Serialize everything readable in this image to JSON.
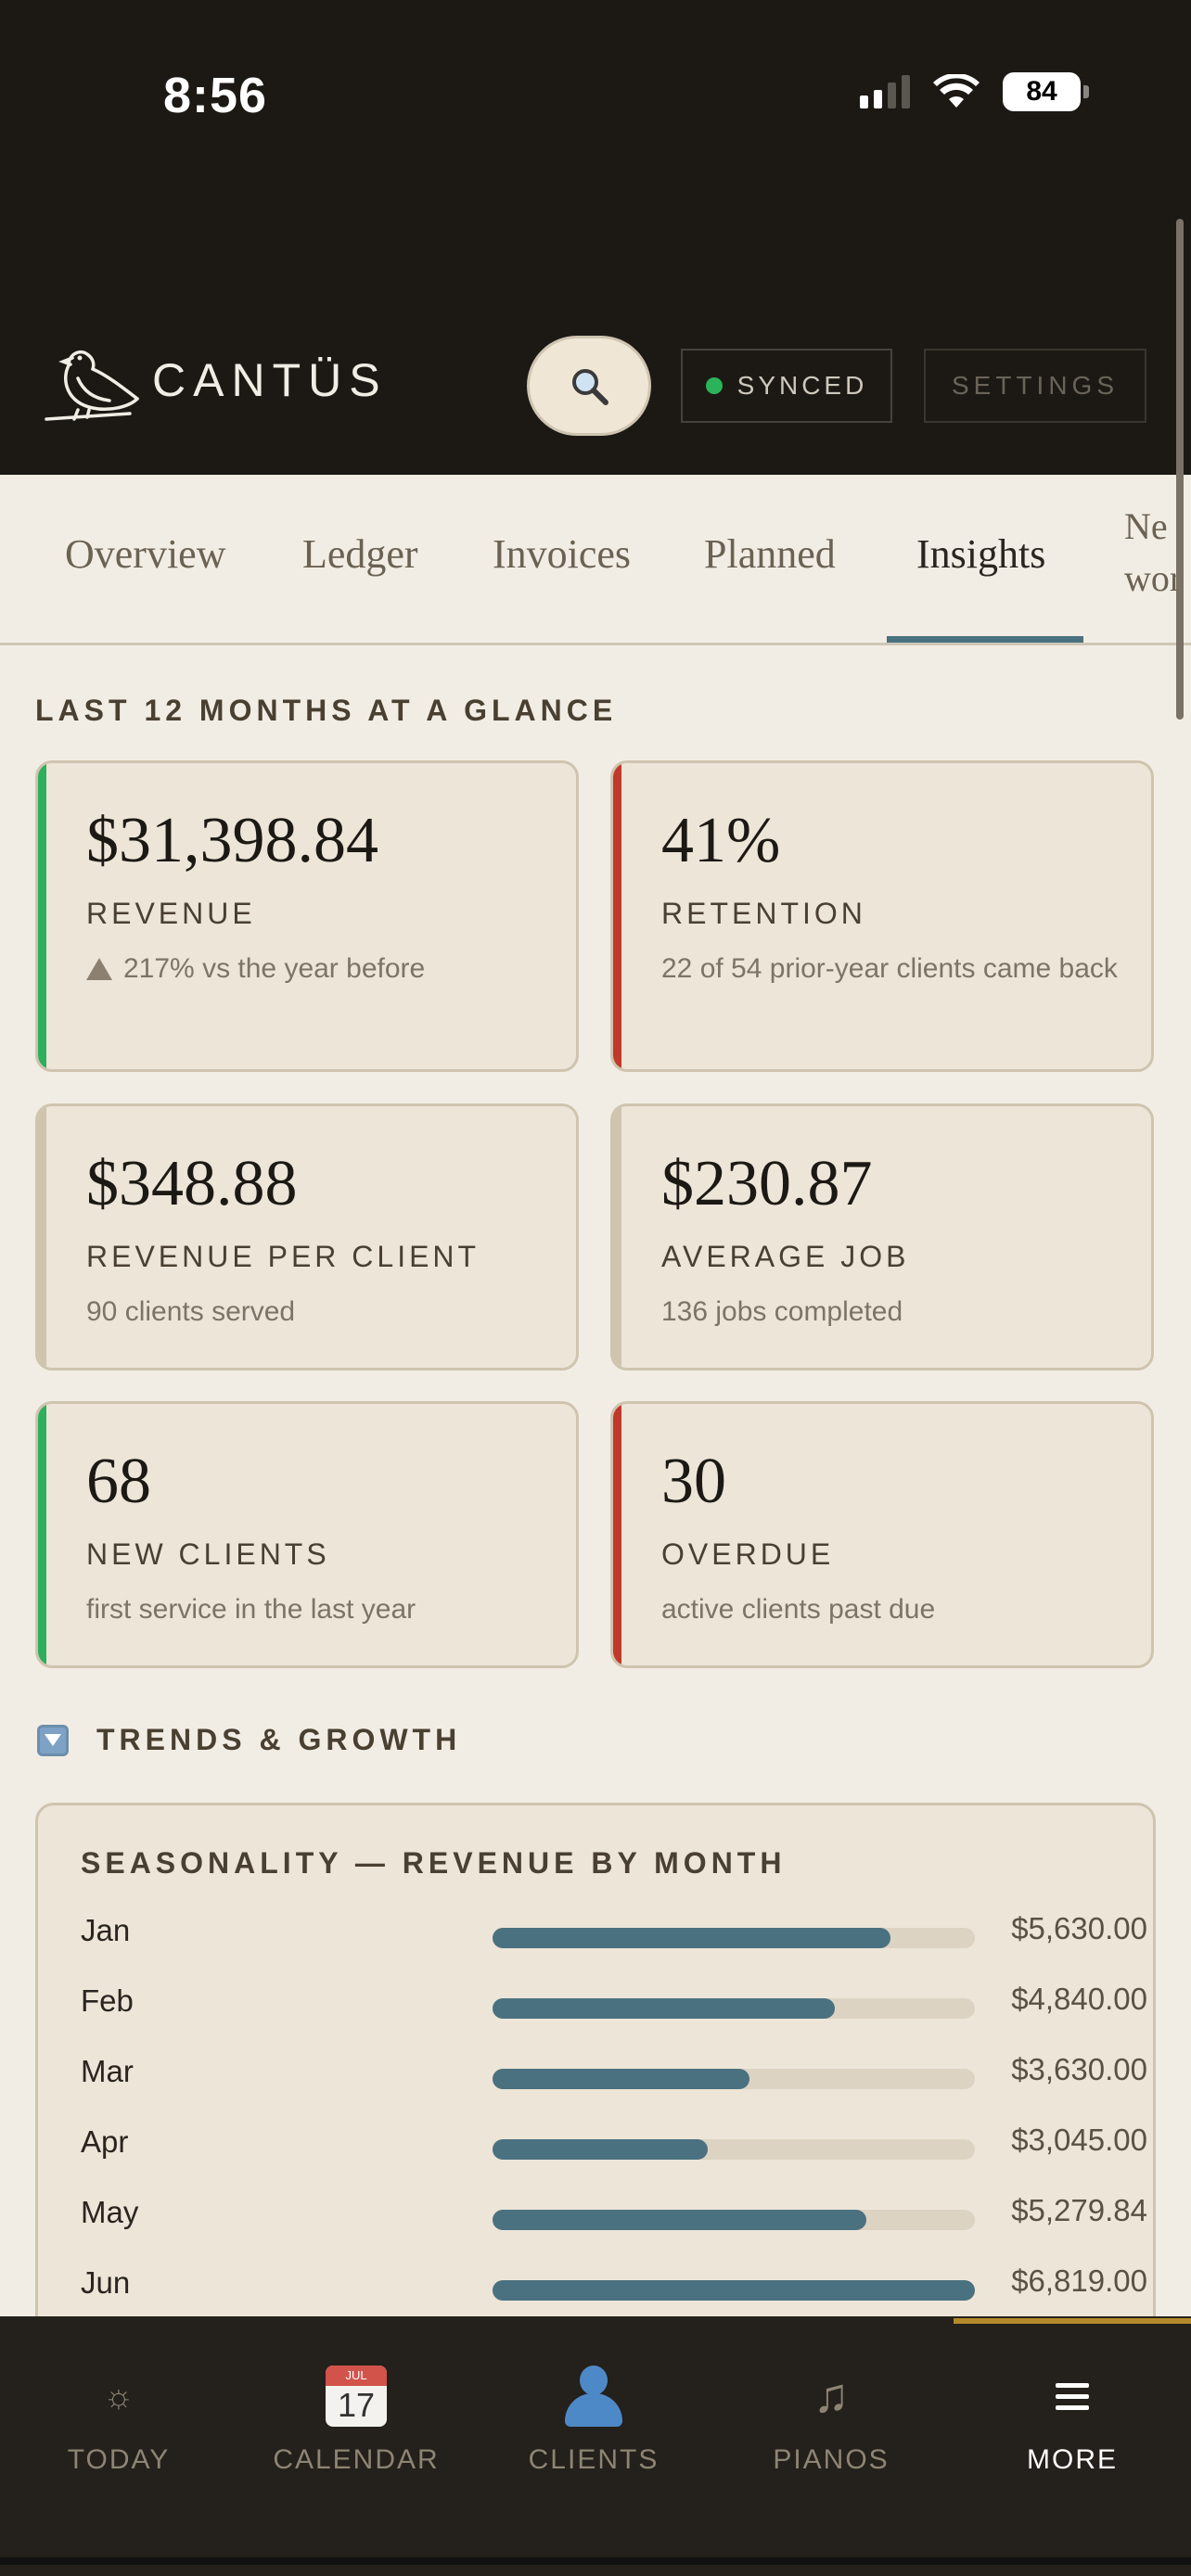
{
  "status_bar": {
    "time": "8:56",
    "battery": "84"
  },
  "header": {
    "logo_text": "CANTÜS",
    "search_icon": "search-icon",
    "synced_label": "SYNCED",
    "settings_label": "SETTINGS",
    "colors": {
      "synced_dot": "#2bb35a",
      "bg": "#1c1915"
    }
  },
  "tabs": [
    {
      "label": "Overview"
    },
    {
      "label": "Ledger"
    },
    {
      "label": "Invoices"
    },
    {
      "label": "Planned"
    },
    {
      "label": "Insights",
      "active": true
    },
    {
      "label": "Ne wor"
    }
  ],
  "glance": {
    "heading": "LAST 12 MONTHS AT A GLANCE",
    "cards": [
      {
        "value": "$31,398.84",
        "label": "REVENUE",
        "sub_icon": "triangle-up-icon",
        "sub": "217% vs the year before",
        "accent": "#2eaf5c"
      },
      {
        "value": "41%",
        "label": "RETENTION",
        "sub": "22 of 54 prior-year clients came back",
        "accent": "#c0392b"
      },
      {
        "value": "$348.88",
        "label": "REVENUE PER CLIENT",
        "sub": "90 clients served",
        "accent": "#cfc4ae"
      },
      {
        "value": "$230.87",
        "label": "AVERAGE JOB",
        "sub": "136 jobs completed",
        "accent": "#cfc4ae"
      },
      {
        "value": "68",
        "label": "NEW CLIENTS",
        "sub": "first service in the last year",
        "accent": "#2eaf5c"
      },
      {
        "value": "30",
        "label": "OVERDUE",
        "sub": "active clients past due",
        "accent": "#c0392b"
      }
    ]
  },
  "trends": {
    "heading": "TRENDS & GROWTH",
    "seasonality_title": "SEASONALITY — REVENUE BY MONTH",
    "months": [
      {
        "name": "Jan",
        "amount": "$5,630.00",
        "value": 5630.0
      },
      {
        "name": "Feb",
        "amount": "$4,840.00",
        "value": 4840.0
      },
      {
        "name": "Mar",
        "amount": "$3,630.00",
        "value": 3630.0
      },
      {
        "name": "Apr",
        "amount": "$3,045.00",
        "value": 3045.0
      },
      {
        "name": "May",
        "amount": "$5,279.84",
        "value": 5279.84
      },
      {
        "name": "Jun",
        "amount": "$6,819.00",
        "value": 6819.0
      }
    ],
    "bar_color": "#4a7180"
  },
  "bottom_nav": [
    {
      "label": "TODAY",
      "icon": "sun-icon"
    },
    {
      "label": "CALENDAR",
      "icon": "calendar-icon",
      "cal_month": "JUL",
      "cal_day": "17"
    },
    {
      "label": "CLIENTS",
      "icon": "person-icon"
    },
    {
      "label": "PIANOS",
      "icon": "music-note-icon"
    },
    {
      "label": "MORE",
      "icon": "menu-icon",
      "active": true
    }
  ]
}
